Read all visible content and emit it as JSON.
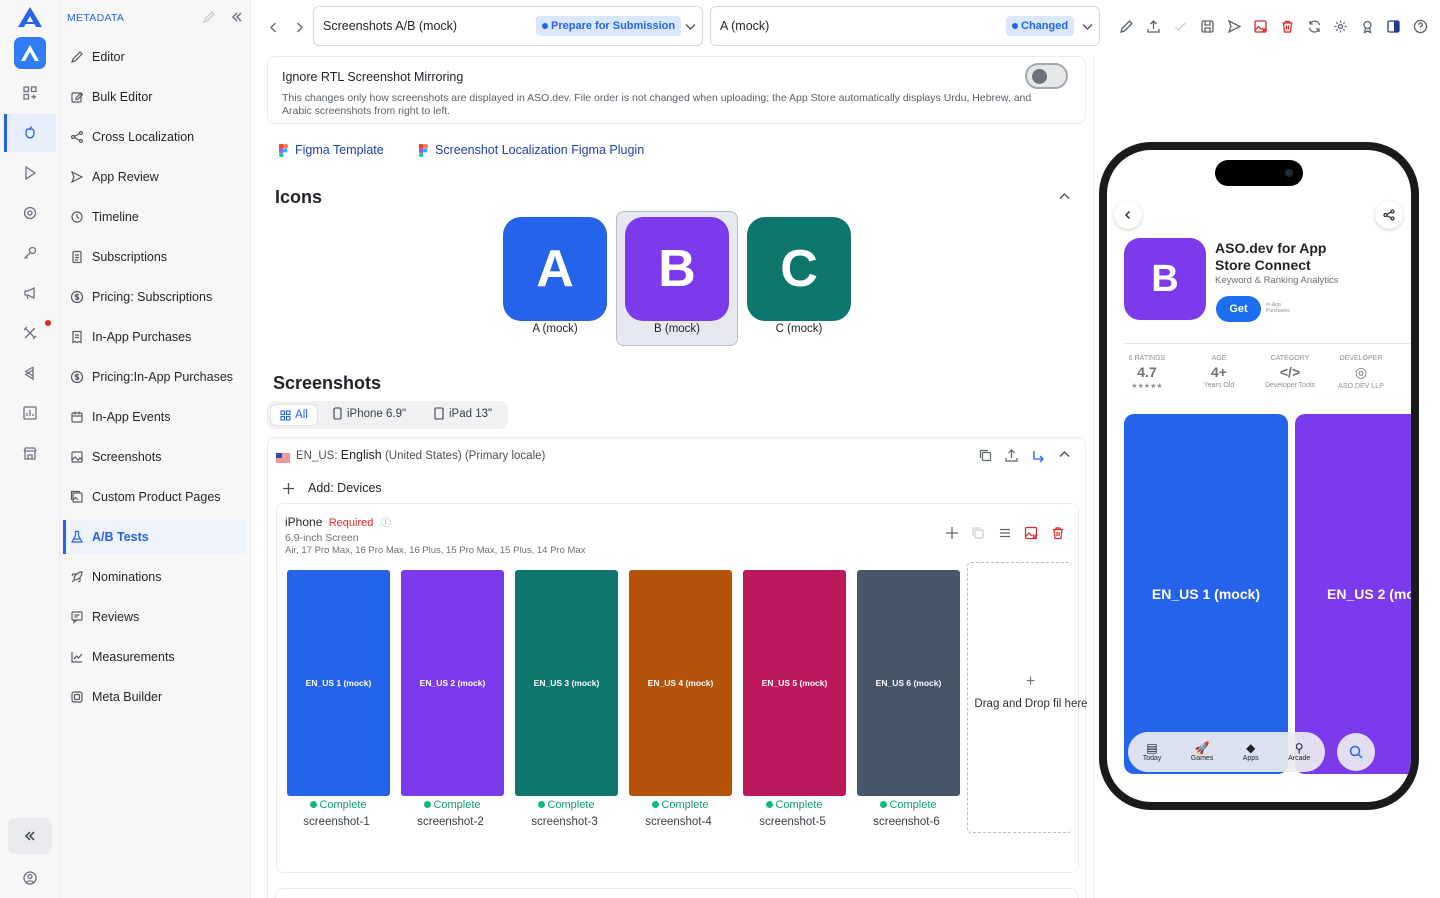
{
  "sidebar": {
    "header": "METADATA",
    "items": [
      {
        "label": "Editor",
        "icon": "pencil-icon"
      },
      {
        "label": "Bulk Editor",
        "icon": "edit-square-icon"
      },
      {
        "label": "Cross Localization",
        "icon": "share-nodes-icon"
      },
      {
        "label": "App Review",
        "icon": "send-icon"
      },
      {
        "label": "Timeline",
        "icon": "history-icon"
      },
      {
        "label": "Subscriptions",
        "icon": "document-icon"
      },
      {
        "label": "Pricing: Subscriptions",
        "icon": "dollar-circle-icon"
      },
      {
        "label": "In-App Purchases",
        "icon": "receipt-icon"
      },
      {
        "label": "Pricing:In-App Purchases",
        "icon": "dollar-circle-icon"
      },
      {
        "label": "In-App Events",
        "icon": "calendar-icon"
      },
      {
        "label": "Screenshots",
        "icon": "image-icon"
      },
      {
        "label": "Custom Product Pages",
        "icon": "gallery-icon"
      },
      {
        "label": "A/B Tests",
        "icon": "flask-icon"
      },
      {
        "label": "Nominations",
        "icon": "rocket-icon"
      },
      {
        "label": "Reviews",
        "icon": "review-icon"
      },
      {
        "label": "Measurements",
        "icon": "chart-icon"
      },
      {
        "label": "Meta Builder",
        "icon": "layers-icon"
      }
    ]
  },
  "toolbar": {
    "test_select": "Screenshots A/B (mock)",
    "test_badge": "Prepare for Submission",
    "treatment_select": "A (mock)",
    "treatment_badge": "Changed"
  },
  "rtl": {
    "title": "Ignore RTL Screenshot Mirroring",
    "description": "This changes only how screenshots are displayed in ASO.dev. File order is not changed when uploading; the App Store automatically displays Urdu, Hebrew, and Arabic screenshots from right to left."
  },
  "links": {
    "figma_template": "Figma Template",
    "figma_plugin": "Screenshot Localization Figma Plugin"
  },
  "icons_section": {
    "title": "Icons",
    "items": [
      {
        "letter": "A",
        "label": "A (mock)",
        "color": "#2563eb"
      },
      {
        "letter": "B",
        "label": "B (mock)",
        "color": "#7c3aed"
      },
      {
        "letter": "C",
        "label": "C (mock)",
        "color": "#0f766e"
      }
    ]
  },
  "screenshots_section": {
    "title": "Screenshots",
    "filters": [
      "All",
      "iPhone 6.9\"",
      "iPad 13\""
    ],
    "locale_code": "EN_US:",
    "locale_name": "English",
    "locale_extra": "(United States) (Primary locale)",
    "add_devices": "Add: Devices",
    "device": {
      "name": "iPhone",
      "required": "Required",
      "screen": "6.9-inch Screen",
      "models": "Air, 17 Pro Max, 16 Pro Max, 16 Plus, 15 Pro Max, 15 Plus, 14 Pro Max"
    },
    "shots": [
      {
        "label": "EN_US 1 (mock)",
        "status": "Complete",
        "file": "screenshot-1",
        "color": "#2563eb"
      },
      {
        "label": "EN_US 2 (mock)",
        "status": "Complete",
        "file": "screenshot-2",
        "color": "#7c3aed"
      },
      {
        "label": "EN_US 3 (mock)",
        "status": "Complete",
        "file": "screenshot-3",
        "color": "#0f766e"
      },
      {
        "label": "EN_US 4 (mock)",
        "status": "Complete",
        "file": "screenshot-4",
        "color": "#b45309"
      },
      {
        "label": "EN_US 5 (mock)",
        "status": "Complete",
        "file": "screenshot-5",
        "color": "#be185d"
      },
      {
        "label": "EN_US 6 (mock)",
        "status": "Complete",
        "file": "screenshot-6",
        "color": "#475569"
      }
    ],
    "drop_text": "Drag and Drop fil here"
  },
  "preview": {
    "app_icon_letter": "B",
    "app_title": "ASO.dev for App Store Connect",
    "app_subtitle": "Keyword & Ranking Analytics",
    "get": "Get",
    "iap": "In-App Purchases",
    "stats": [
      {
        "h": "6 RATINGS",
        "v": "4.7",
        "s": "★★★★★"
      },
      {
        "h": "AGE",
        "v": "4+",
        "s": "Years Old"
      },
      {
        "h": "CATEGORY",
        "v": "</>",
        "s": "Developer Tools"
      },
      {
        "h": "DEVELOPER",
        "v": "◎",
        "s": "ASO.DEV LLP"
      }
    ],
    "shot1": "EN_US 1 (mock)",
    "shot2": "EN_US 2 (mo",
    "tabs": [
      "Today",
      "Games",
      "Apps",
      "Arcade"
    ]
  }
}
